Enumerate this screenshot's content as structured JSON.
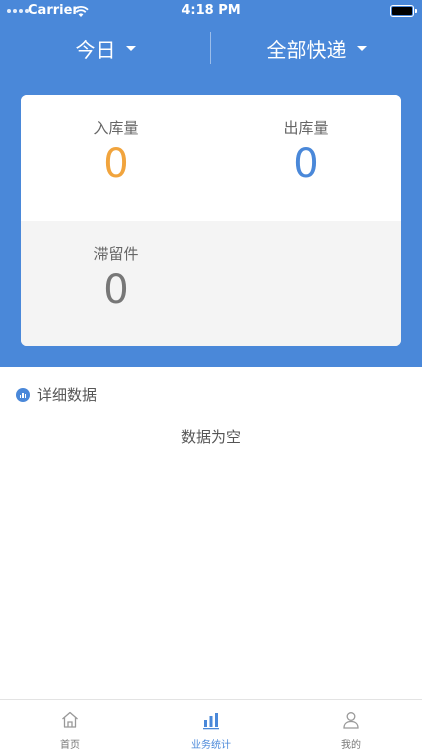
{
  "status_bar": {
    "carrier": "Carrier",
    "time": "4:18 PM"
  },
  "filters": {
    "date": "今日",
    "courier": "全部快递"
  },
  "stats": {
    "inbound_label": "入库量",
    "inbound_value": "0",
    "outbound_label": "出库量",
    "outbound_value": "0",
    "stranded_label": "滞留件",
    "stranded_value": "0"
  },
  "detail": {
    "title": "详细数据",
    "empty_text": "数据为空"
  },
  "tabbar": {
    "items": [
      {
        "label": "首页",
        "icon": "home-icon"
      },
      {
        "label": "业务统计",
        "icon": "bar-chart-icon"
      },
      {
        "label": "我的",
        "icon": "person-icon"
      }
    ],
    "active_color": "#4a88d9"
  },
  "colors": {
    "header": "#4a88d9",
    "inbound": "#f1a43d",
    "outbound": "#4a88d9",
    "stranded": "#777777"
  }
}
